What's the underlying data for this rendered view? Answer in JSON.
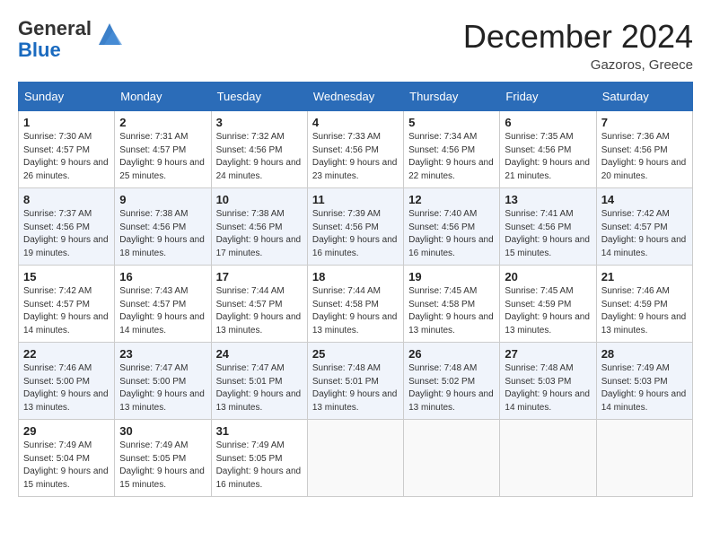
{
  "header": {
    "logo_general": "General",
    "logo_blue": "Blue",
    "month_title": "December 2024",
    "location": "Gazoros, Greece"
  },
  "days_of_week": [
    "Sunday",
    "Monday",
    "Tuesday",
    "Wednesday",
    "Thursday",
    "Friday",
    "Saturday"
  ],
  "weeks": [
    [
      {
        "day": "1",
        "sunrise": "7:30 AM",
        "sunset": "4:57 PM",
        "daylight": "9 hours and 26 minutes."
      },
      {
        "day": "2",
        "sunrise": "7:31 AM",
        "sunset": "4:57 PM",
        "daylight": "9 hours and 25 minutes."
      },
      {
        "day": "3",
        "sunrise": "7:32 AM",
        "sunset": "4:56 PM",
        "daylight": "9 hours and 24 minutes."
      },
      {
        "day": "4",
        "sunrise": "7:33 AM",
        "sunset": "4:56 PM",
        "daylight": "9 hours and 23 minutes."
      },
      {
        "day": "5",
        "sunrise": "7:34 AM",
        "sunset": "4:56 PM",
        "daylight": "9 hours and 22 minutes."
      },
      {
        "day": "6",
        "sunrise": "7:35 AM",
        "sunset": "4:56 PM",
        "daylight": "9 hours and 21 minutes."
      },
      {
        "day": "7",
        "sunrise": "7:36 AM",
        "sunset": "4:56 PM",
        "daylight": "9 hours and 20 minutes."
      }
    ],
    [
      {
        "day": "8",
        "sunrise": "7:37 AM",
        "sunset": "4:56 PM",
        "daylight": "9 hours and 19 minutes."
      },
      {
        "day": "9",
        "sunrise": "7:38 AM",
        "sunset": "4:56 PM",
        "daylight": "9 hours and 18 minutes."
      },
      {
        "day": "10",
        "sunrise": "7:38 AM",
        "sunset": "4:56 PM",
        "daylight": "9 hours and 17 minutes."
      },
      {
        "day": "11",
        "sunrise": "7:39 AM",
        "sunset": "4:56 PM",
        "daylight": "9 hours and 16 minutes."
      },
      {
        "day": "12",
        "sunrise": "7:40 AM",
        "sunset": "4:56 PM",
        "daylight": "9 hours and 16 minutes."
      },
      {
        "day": "13",
        "sunrise": "7:41 AM",
        "sunset": "4:56 PM",
        "daylight": "9 hours and 15 minutes."
      },
      {
        "day": "14",
        "sunrise": "7:42 AM",
        "sunset": "4:57 PM",
        "daylight": "9 hours and 14 minutes."
      }
    ],
    [
      {
        "day": "15",
        "sunrise": "7:42 AM",
        "sunset": "4:57 PM",
        "daylight": "9 hours and 14 minutes."
      },
      {
        "day": "16",
        "sunrise": "7:43 AM",
        "sunset": "4:57 PM",
        "daylight": "9 hours and 14 minutes."
      },
      {
        "day": "17",
        "sunrise": "7:44 AM",
        "sunset": "4:57 PM",
        "daylight": "9 hours and 13 minutes."
      },
      {
        "day": "18",
        "sunrise": "7:44 AM",
        "sunset": "4:58 PM",
        "daylight": "9 hours and 13 minutes."
      },
      {
        "day": "19",
        "sunrise": "7:45 AM",
        "sunset": "4:58 PM",
        "daylight": "9 hours and 13 minutes."
      },
      {
        "day": "20",
        "sunrise": "7:45 AM",
        "sunset": "4:59 PM",
        "daylight": "9 hours and 13 minutes."
      },
      {
        "day": "21",
        "sunrise": "7:46 AM",
        "sunset": "4:59 PM",
        "daylight": "9 hours and 13 minutes."
      }
    ],
    [
      {
        "day": "22",
        "sunrise": "7:46 AM",
        "sunset": "5:00 PM",
        "daylight": "9 hours and 13 minutes."
      },
      {
        "day": "23",
        "sunrise": "7:47 AM",
        "sunset": "5:00 PM",
        "daylight": "9 hours and 13 minutes."
      },
      {
        "day": "24",
        "sunrise": "7:47 AM",
        "sunset": "5:01 PM",
        "daylight": "9 hours and 13 minutes."
      },
      {
        "day": "25",
        "sunrise": "7:48 AM",
        "sunset": "5:01 PM",
        "daylight": "9 hours and 13 minutes."
      },
      {
        "day": "26",
        "sunrise": "7:48 AM",
        "sunset": "5:02 PM",
        "daylight": "9 hours and 13 minutes."
      },
      {
        "day": "27",
        "sunrise": "7:48 AM",
        "sunset": "5:03 PM",
        "daylight": "9 hours and 14 minutes."
      },
      {
        "day": "28",
        "sunrise": "7:49 AM",
        "sunset": "5:03 PM",
        "daylight": "9 hours and 14 minutes."
      }
    ],
    [
      {
        "day": "29",
        "sunrise": "7:49 AM",
        "sunset": "5:04 PM",
        "daylight": "9 hours and 15 minutes."
      },
      {
        "day": "30",
        "sunrise": "7:49 AM",
        "sunset": "5:05 PM",
        "daylight": "9 hours and 15 minutes."
      },
      {
        "day": "31",
        "sunrise": "7:49 AM",
        "sunset": "5:05 PM",
        "daylight": "9 hours and 16 minutes."
      },
      null,
      null,
      null,
      null
    ]
  ],
  "labels": {
    "sunrise": "Sunrise:",
    "sunset": "Sunset:",
    "daylight": "Daylight:"
  }
}
